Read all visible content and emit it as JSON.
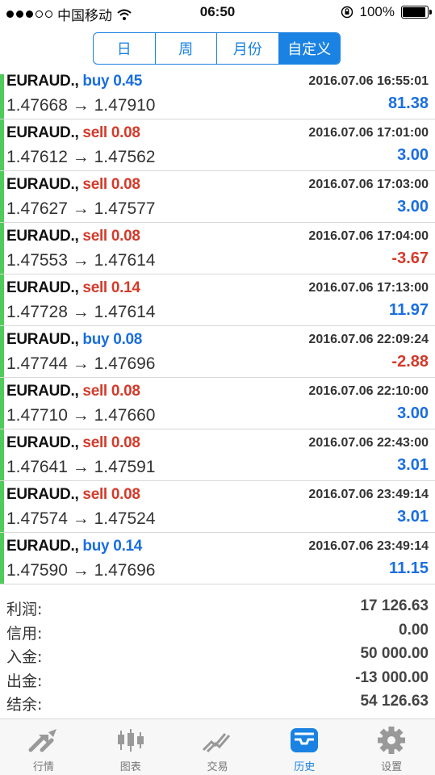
{
  "status_bar": {
    "carrier": "中国移动",
    "time": "06:50",
    "battery": "100%"
  },
  "period_tabs": [
    {
      "label": "日"
    },
    {
      "label": "周"
    },
    {
      "label": "月份"
    },
    {
      "label": "自定义",
      "selected": true
    }
  ],
  "deals": [
    {
      "symbol": "EURAUD.,",
      "side": "buy",
      "volume": "0.45",
      "time": "2016.07.06 16:55:01",
      "prices": "1.47668 → 1.47910",
      "profit": "81.38"
    },
    {
      "symbol": "EURAUD.,",
      "side": "sell",
      "volume": "0.08",
      "time": "2016.07.06 17:01:00",
      "prices": "1.47612 → 1.47562",
      "profit": "3.00"
    },
    {
      "symbol": "EURAUD.,",
      "side": "sell",
      "volume": "0.08",
      "time": "2016.07.06 17:03:00",
      "prices": "1.47627 → 1.47577",
      "profit": "3.00"
    },
    {
      "symbol": "EURAUD.,",
      "side": "sell",
      "volume": "0.08",
      "time": "2016.07.06 17:04:00",
      "prices": "1.47553 → 1.47614",
      "profit": "-3.67"
    },
    {
      "symbol": "EURAUD.,",
      "side": "sell",
      "volume": "0.14",
      "time": "2016.07.06 17:13:00",
      "prices": "1.47728 → 1.47614",
      "profit": "11.97"
    },
    {
      "symbol": "EURAUD.,",
      "side": "buy",
      "volume": "0.08",
      "time": "2016.07.06 22:09:24",
      "prices": "1.47744 → 1.47696",
      "profit": "-2.88"
    },
    {
      "symbol": "EURAUD.,",
      "side": "sell",
      "volume": "0.08",
      "time": "2016.07.06 22:10:00",
      "prices": "1.47710 → 1.47660",
      "profit": "3.00"
    },
    {
      "symbol": "EURAUD.,",
      "side": "sell",
      "volume": "0.08",
      "time": "2016.07.06 22:43:00",
      "prices": "1.47641 → 1.47591",
      "profit": "3.01"
    },
    {
      "symbol": "EURAUD.,",
      "side": "sell",
      "volume": "0.08",
      "time": "2016.07.06 23:49:14",
      "prices": "1.47574 → 1.47524",
      "profit": "3.01"
    },
    {
      "symbol": "EURAUD.,",
      "side": "buy",
      "volume": "0.14",
      "time": "2016.07.06 23:49:14",
      "prices": "1.47590 → 1.47696",
      "profit": "11.15"
    }
  ],
  "summary": [
    {
      "label": "利润:",
      "value": "17 126.63"
    },
    {
      "label": "信用:",
      "value": "0.00"
    },
    {
      "label": "入金:",
      "value": "50 000.00"
    },
    {
      "label": "出金:",
      "value": "-13 000.00"
    },
    {
      "label": "结余:",
      "value": "54 126.63"
    }
  ],
  "tabbar": [
    {
      "label": "行情",
      "icon": "quotes-arrows-icon"
    },
    {
      "label": "图表",
      "icon": "candlestick-chart-icon"
    },
    {
      "label": "交易",
      "icon": "trade-chart-icon"
    },
    {
      "label": "历史",
      "icon": "history-tray-icon",
      "active": true
    },
    {
      "label": "设置",
      "icon": "gear-icon"
    }
  ],
  "colors": {
    "accent": "#1a82e2",
    "buy": "#1a6ee0",
    "sell": "#d43a2a",
    "row_marker": "#4fcb5a"
  }
}
